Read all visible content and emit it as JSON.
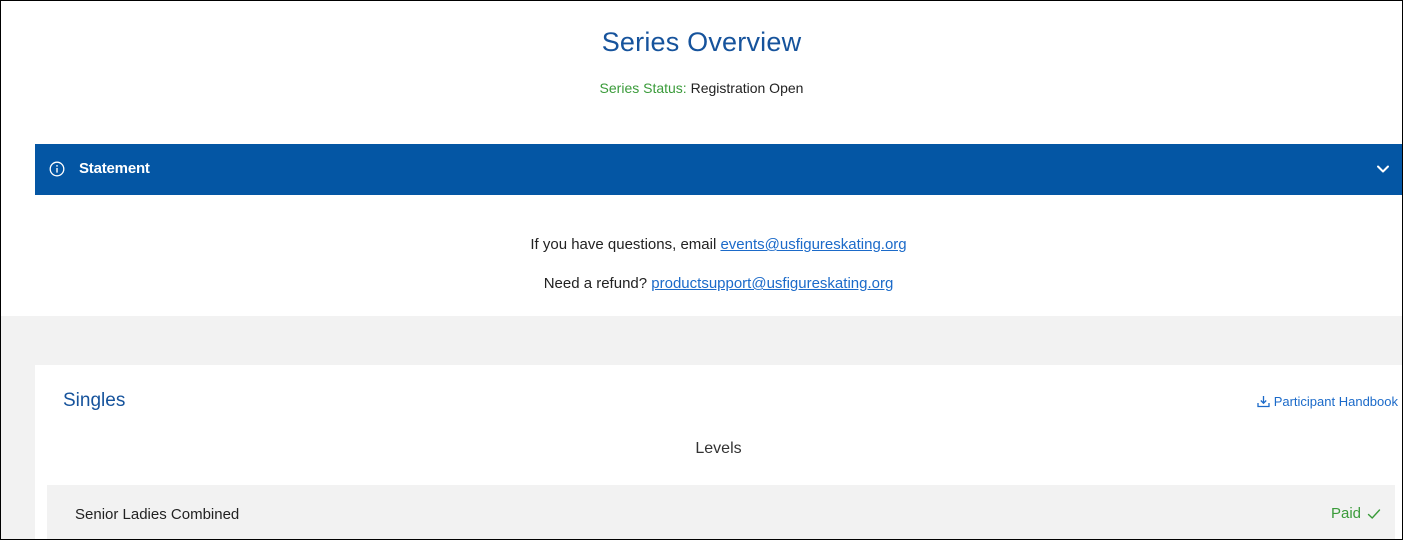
{
  "header": {
    "title": "Series Overview",
    "status_label": "Series Status:",
    "status_value": "Registration Open"
  },
  "statement": {
    "label": "Statement",
    "icon": "info-icon",
    "toggle_icon": "chevron-down-icon"
  },
  "contacts": {
    "questions_text": "If you have questions, email",
    "questions_email": "events@usfigureskating.org",
    "refund_text": "Need a refund?",
    "refund_email": "productsupport@usfigureskating.org"
  },
  "singles": {
    "title": "Singles",
    "handbook_label": "Participant Handbook",
    "handbook_icon": "download-icon",
    "levels_heading": "Levels",
    "levels": [
      {
        "name": "Senior Ladies Combined",
        "status": "Paid",
        "status_icon": "check-icon"
      }
    ]
  },
  "colors": {
    "accent_blue": "#0456a4",
    "title_blue": "#16539c",
    "link_blue": "#1b6ac9",
    "status_green": "#3a9b3a",
    "grey_bg": "#f2f2f2"
  }
}
